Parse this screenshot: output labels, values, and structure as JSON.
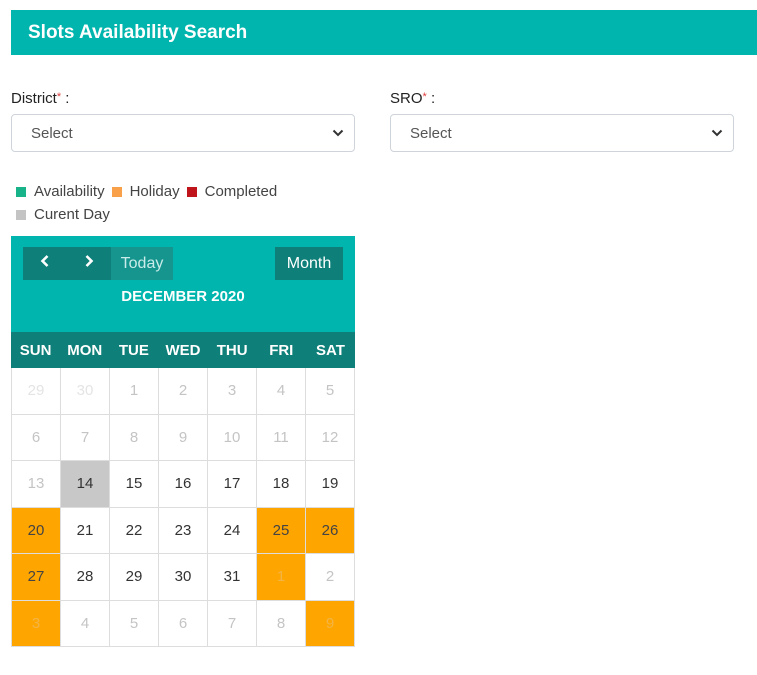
{
  "header": {
    "title": "Slots Availability Search"
  },
  "form": {
    "district": {
      "label": "District",
      "required_mark": "*",
      "suffix": " :",
      "value": "Select"
    },
    "sro": {
      "label": "SRO",
      "required_mark": "*",
      "suffix": " :",
      "value": "Select"
    }
  },
  "legend": [
    {
      "label": "Availability",
      "color": "#19b38a"
    },
    {
      "label": "Holiday",
      "color": "#f8a14a"
    },
    {
      "label": "Completed",
      "color": "#c0141b"
    },
    {
      "label": "Curent Day",
      "color": "#c4c4c4"
    }
  ],
  "calendar": {
    "prev_icon": "chevron-left-icon",
    "next_icon": "chevron-right-icon",
    "today_label": "Today",
    "month_label": "Month",
    "title": "DECEMBER 2020",
    "weekdays": [
      "SUN",
      "MON",
      "TUE",
      "WED",
      "THU",
      "FRI",
      "SAT"
    ],
    "colors": {
      "header": "#00b5ad",
      "dark": "#0e8079",
      "holiday": "#ffa500",
      "current": "#c8c8c8"
    },
    "weeks": [
      [
        {
          "day": "29",
          "state": "other"
        },
        {
          "day": "30",
          "state": "other"
        },
        {
          "day": "1",
          "state": "past"
        },
        {
          "day": "2",
          "state": "past"
        },
        {
          "day": "3",
          "state": "past"
        },
        {
          "day": "4",
          "state": "past"
        },
        {
          "day": "5",
          "state": "past"
        }
      ],
      [
        {
          "day": "6",
          "state": "past"
        },
        {
          "day": "7",
          "state": "past"
        },
        {
          "day": "8",
          "state": "past"
        },
        {
          "day": "9",
          "state": "past"
        },
        {
          "day": "10",
          "state": "past"
        },
        {
          "day": "11",
          "state": "past"
        },
        {
          "day": "12",
          "state": "past"
        }
      ],
      [
        {
          "day": "13",
          "state": "past"
        },
        {
          "day": "14",
          "state": "current"
        },
        {
          "day": "15",
          "state": "normal"
        },
        {
          "day": "16",
          "state": "normal"
        },
        {
          "day": "17",
          "state": "normal"
        },
        {
          "day": "18",
          "state": "normal"
        },
        {
          "day": "19",
          "state": "normal"
        }
      ],
      [
        {
          "day": "20",
          "state": "holiday"
        },
        {
          "day": "21",
          "state": "normal"
        },
        {
          "day": "22",
          "state": "normal"
        },
        {
          "day": "23",
          "state": "normal"
        },
        {
          "day": "24",
          "state": "normal"
        },
        {
          "day": "25",
          "state": "holiday"
        },
        {
          "day": "26",
          "state": "holiday"
        }
      ],
      [
        {
          "day": "27",
          "state": "holiday"
        },
        {
          "day": "28",
          "state": "normal"
        },
        {
          "day": "29",
          "state": "normal"
        },
        {
          "day": "30",
          "state": "normal"
        },
        {
          "day": "31",
          "state": "normal"
        },
        {
          "day": "1",
          "state": "holiday-other"
        },
        {
          "day": "2",
          "state": "other-light"
        }
      ],
      [
        {
          "day": "3",
          "state": "holiday-other"
        },
        {
          "day": "4",
          "state": "other-light"
        },
        {
          "day": "5",
          "state": "other-light"
        },
        {
          "day": "6",
          "state": "other-light"
        },
        {
          "day": "7",
          "state": "other-light"
        },
        {
          "day": "8",
          "state": "other-light"
        },
        {
          "day": "9",
          "state": "holiday-other"
        }
      ]
    ]
  }
}
